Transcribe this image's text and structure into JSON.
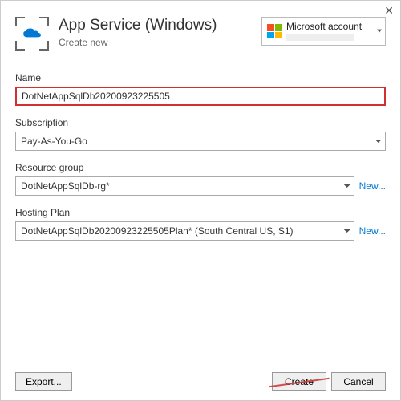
{
  "header": {
    "title": "App Service (Windows)",
    "subtitle": "Create new"
  },
  "account": {
    "label": "Microsoft account"
  },
  "fields": {
    "name": {
      "label": "Name",
      "value": "DotNetAppSqlDb20200923225505"
    },
    "subscription": {
      "label": "Subscription",
      "value": "Pay-As-You-Go"
    },
    "resourceGroup": {
      "label": "Resource group",
      "value": "DotNetAppSqlDb-rg*",
      "newLabel": "New..."
    },
    "hostingPlan": {
      "label": "Hosting Plan",
      "value": "DotNetAppSqlDb20200923225505Plan* (South Central US, S1)",
      "newLabel": "New..."
    }
  },
  "footer": {
    "export": "Export...",
    "create": "Create",
    "cancel": "Cancel"
  }
}
